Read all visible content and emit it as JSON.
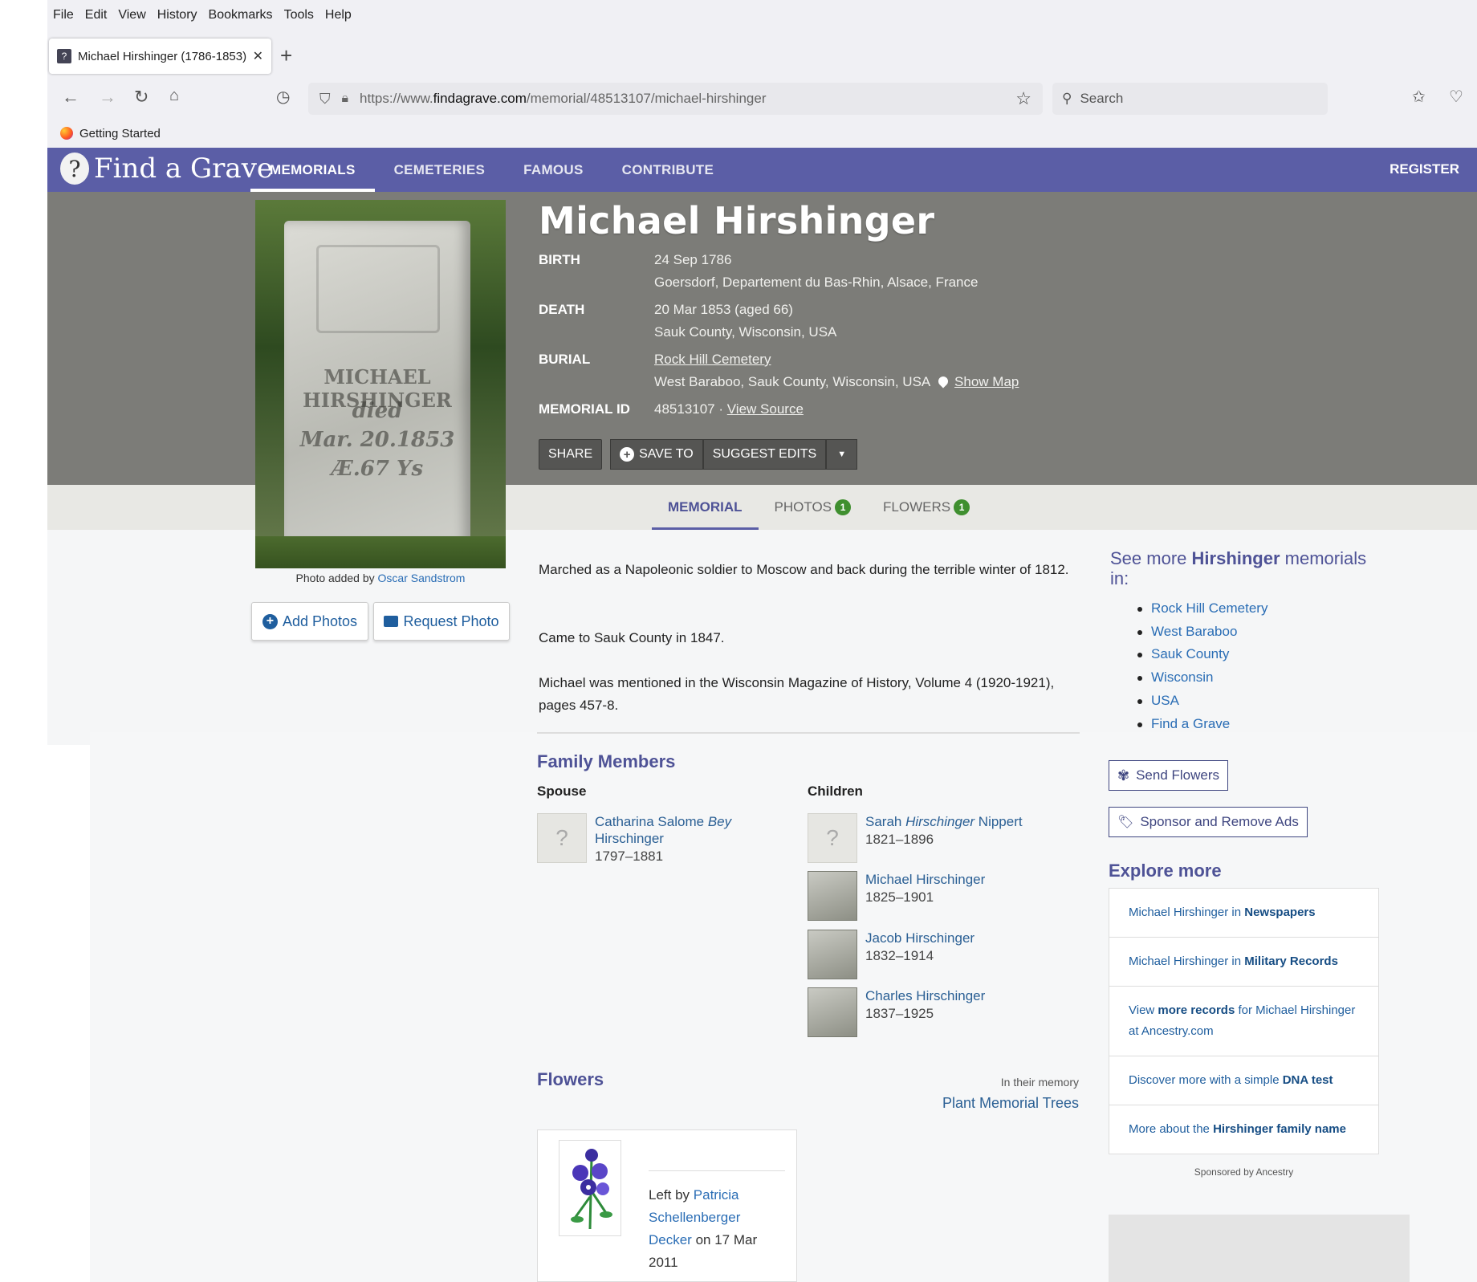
{
  "browser": {
    "menu": [
      "File",
      "Edit",
      "View",
      "History",
      "Bookmarks",
      "Tools",
      "Help"
    ],
    "tab_title": "Michael Hirshinger (1786-1853)",
    "url_prefix": "https://www.",
    "url_domain": "findagrave.com",
    "url_path": "/memorial/48513107/michael-hirshinger",
    "search_placeholder": "Search",
    "bookmark": "Getting Started"
  },
  "site": {
    "logo": "Find a Grave",
    "nav": [
      "MEMORIALS",
      "CEMETERIES",
      "FAMOUS",
      "CONTRIBUTE"
    ],
    "register": "REGISTER"
  },
  "memorial": {
    "name": "Michael Hirshinger",
    "birth_label": "BIRTH",
    "birth_date": "24 Sep 1786",
    "birth_place": "Goersdorf, Departement du Bas-Rhin, Alsace, France",
    "death_label": "DEATH",
    "death_date": "20 Mar 1853 (aged 66)",
    "death_place": "Sauk County, Wisconsin, USA",
    "burial_label": "BURIAL",
    "burial_cemetery": "Rock Hill Cemetery",
    "burial_place": "West Baraboo, Sauk County, Wisconsin, USA",
    "show_map": "Show Map",
    "id_label": "MEMORIAL ID",
    "id_value": "48513107 ·",
    "view_source": "View Source",
    "stone_text": [
      "MICHAEL HIRSHINGER",
      "died",
      "Mar. 20.1853",
      "Æ.67 Ys"
    ]
  },
  "actions": {
    "share": "SHARE",
    "save_to": "SAVE TO",
    "suggest": "SUGGEST EDITS"
  },
  "photo": {
    "caption_prefix": "Photo added by",
    "caption_author": "Oscar Sandstrom",
    "add_photos": "Add Photos",
    "request_photo": "Request Photo"
  },
  "tabs": {
    "memorial": "MEMORIAL",
    "photos": "PHOTOS",
    "photos_count": "1",
    "flowers": "FLOWERS",
    "flowers_count": "1"
  },
  "bio": [
    "Marched as a Napoleonic soldier to Moscow and back during the terrible winter of 1812.",
    "Came to Sauk County in 1847.",
    "Michael was mentioned in the Wisconsin Magazine of History, Volume 4 (1920-1921), pages 457-8."
  ],
  "family": {
    "title": "Family Members",
    "spouse_label": "Spouse",
    "children_label": "Children",
    "spouse": {
      "first": "Catharina Salome ",
      "maiden": "Bey",
      "last": "Hirschinger",
      "years": "1797–1881"
    },
    "children": [
      {
        "first": "Sarah ",
        "maiden": "Hirschinger",
        "last": " Nippert",
        "years": "1821–1896"
      },
      {
        "first": "Michael Hirschinger",
        "maiden": "",
        "last": "",
        "years": "1825–1901"
      },
      {
        "first": "Jacob Hirschinger",
        "maiden": "",
        "last": "",
        "years": "1832–1914"
      },
      {
        "first": "Charles Hirschinger",
        "maiden": "",
        "last": "",
        "years": "1837–1925"
      }
    ]
  },
  "flowers": {
    "title": "Flowers",
    "in_memory": "In their memory",
    "plant_trees": "Plant Memorial Trees",
    "left_by_prefix": "Left by",
    "left_by_name": "Patricia Schellenberger Decker",
    "left_on": "on 17 Mar 2011"
  },
  "sidebar": {
    "see_more_prefix": "See more",
    "see_more_name": "Hirshinger",
    "see_more_suffix": "memorials in:",
    "locations": [
      "Rock Hill Cemetery",
      "West Baraboo",
      "Sauk County",
      "Wisconsin",
      "USA",
      "Find a Grave"
    ],
    "send_flowers": "Send Flowers",
    "sponsor": "Sponsor and Remove Ads",
    "explore_title": "Explore more",
    "explore": [
      {
        "pre": "Michael Hirshinger in ",
        "bold": "Newspapers",
        "post": ""
      },
      {
        "pre": "Michael Hirshinger in ",
        "bold": "Military Records",
        "post": ""
      },
      {
        "pre": "View ",
        "bold": "more records",
        "post": " for Michael Hirshinger at Ancestry.com"
      },
      {
        "pre": "Discover more with a simple ",
        "bold": "DNA test",
        "post": ""
      },
      {
        "pre": "More about the ",
        "bold": "Hirshinger family name",
        "post": ""
      }
    ],
    "sponsored_by": "Sponsored by Ancestry"
  },
  "colors": {
    "header": "#5b5ea6",
    "hero": "#7c7c78",
    "link": "#2a6db5",
    "badge": "#3f8f2f"
  }
}
